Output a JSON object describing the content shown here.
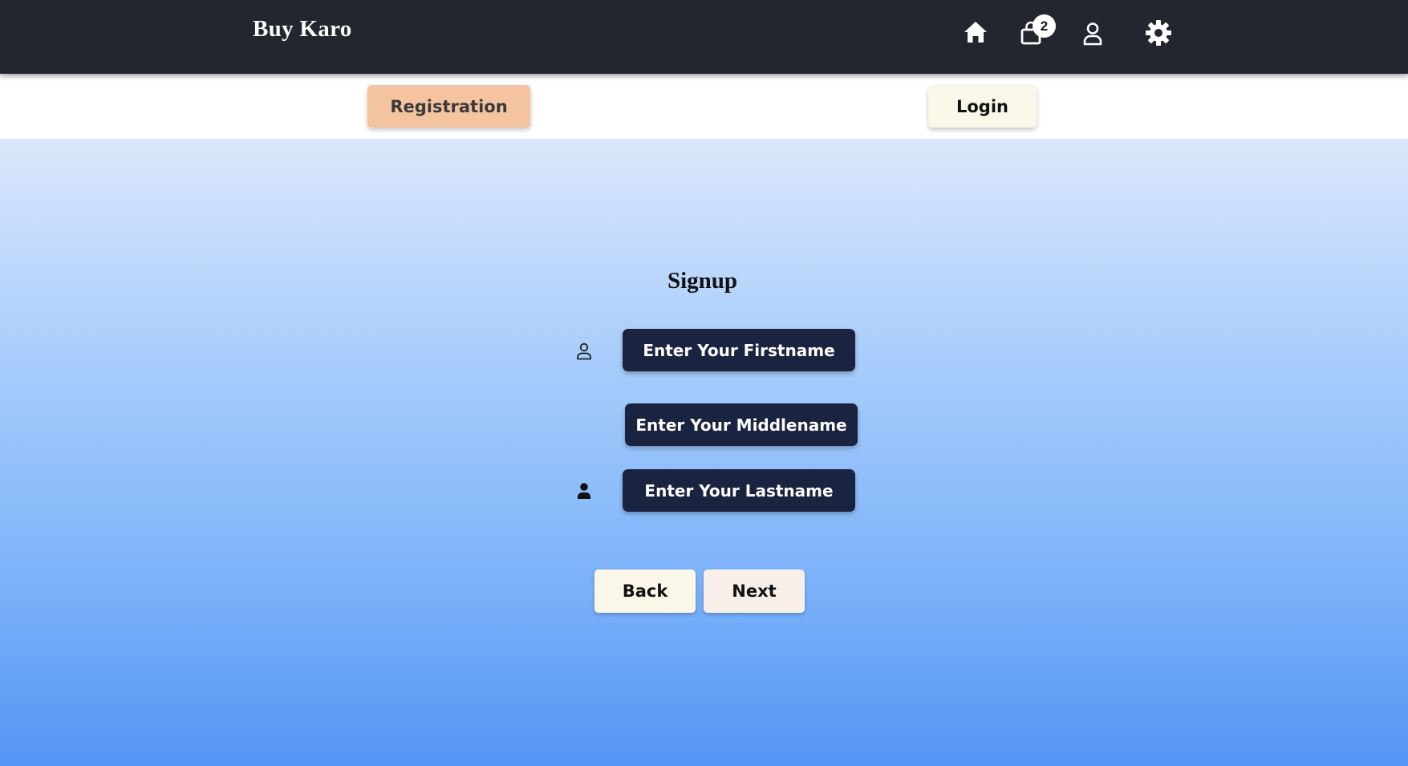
{
  "header": {
    "brand": "Buy Karo",
    "cart_count": "2",
    "icons": [
      "home-icon",
      "shopping-bag-icon",
      "user-icon",
      "gear-icon"
    ]
  },
  "tabs": {
    "registration_label": "Registration",
    "login_label": "Login"
  },
  "form": {
    "title": "Signup",
    "firstname_placeholder": "Enter Your Firstname",
    "middlename_placeholder": "Enter Your Middlename",
    "lastname_placeholder": "Enter Your Lastname",
    "firstname_icon": "user-outline-icon",
    "lastname_icon": "user-filled-icon",
    "back_label": "Back",
    "next_label": "Next"
  },
  "colors": {
    "nav_background": "#23252f",
    "input_background": "#1a2340",
    "registration_tab": "#f4c3a0",
    "button_cream": "#fbf7e8",
    "gradient_top": "#dbe7fc",
    "gradient_bottom": "#5495f5"
  }
}
